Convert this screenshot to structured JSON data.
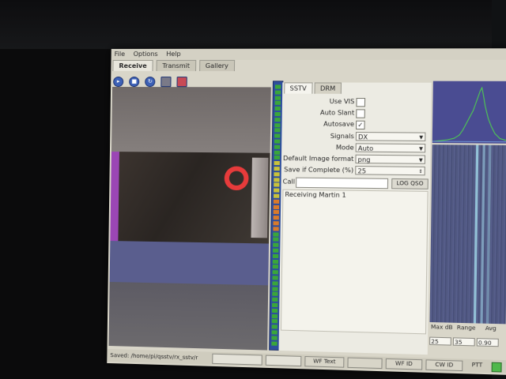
{
  "menu": [
    "File",
    "Options",
    "Help"
  ],
  "tabs": {
    "receive": "Receive",
    "transmit": "Transmit",
    "gallery": "Gallery"
  },
  "toolbar_icons": [
    "start-icon",
    "stop-icon",
    "refresh-icon",
    "save-icon",
    "erase-icon"
  ],
  "panel_tabs": {
    "sstv": "SSTV",
    "drm": "DRM"
  },
  "settings": {
    "use_vis": {
      "label": "Use VIS",
      "checked": false
    },
    "auto_slant": {
      "label": "Auto Slant",
      "checked": false
    },
    "autosave": {
      "label": "Autosave",
      "checked": true,
      "mark": "✓"
    },
    "signals": {
      "label": "Signals",
      "value": "DX"
    },
    "mode": {
      "label": "Mode",
      "value": "Auto"
    },
    "image_format": {
      "label": "Default Image format",
      "value": "png"
    },
    "save_if_complete": {
      "label": "Save if Complete (%)",
      "value": "25"
    }
  },
  "call": {
    "label": "Call",
    "value": ""
  },
  "log_qso_label": "LOG QSO",
  "log_text": "Receiving Martin 1",
  "waterfall_controls": {
    "labels": [
      "Max dB",
      "Range",
      "Avg"
    ],
    "values": [
      "25",
      "35",
      "0.90"
    ]
  },
  "statusbar": {
    "saved_text": "Saved: /home/pi/qsstv/rx_sstv/r",
    "wf_text_label": "WF Text",
    "wf_id_label": "WF ID",
    "cw_id_label": "CW ID",
    "ptt_label": "PTT"
  },
  "colors": {
    "ptt": "#4fb84b",
    "vu_track": "#2d4e9d",
    "button_blue": "#3d61b6"
  }
}
